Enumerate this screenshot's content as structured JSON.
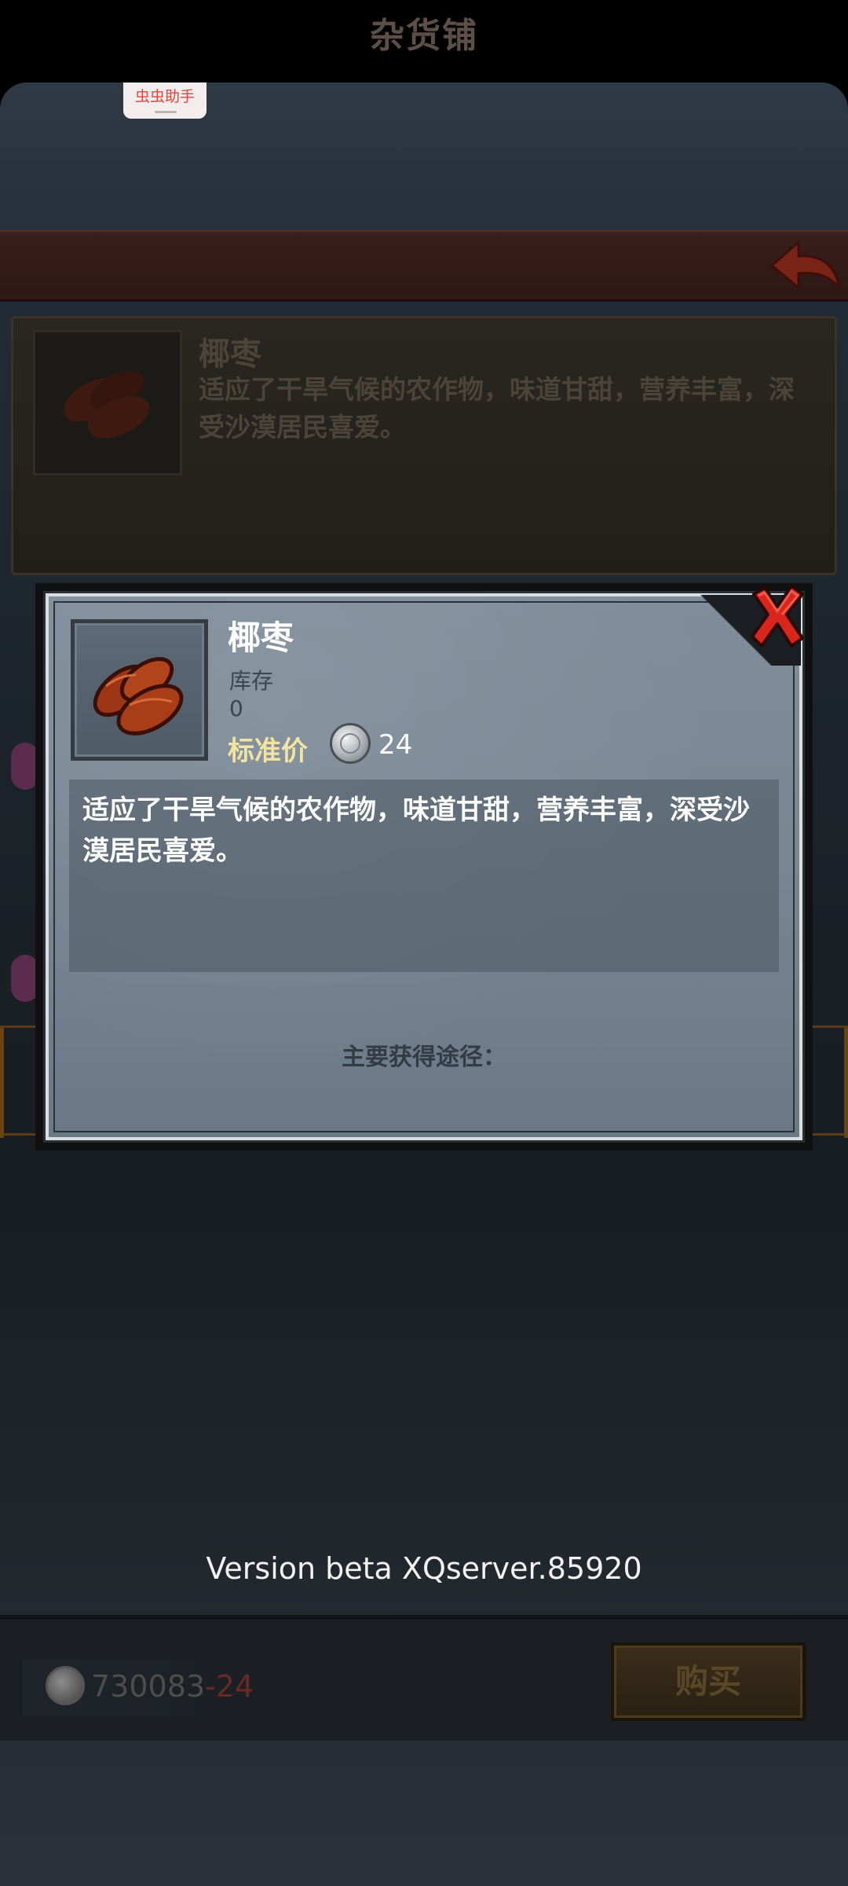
{
  "helper_tag": "虫虫助手",
  "shop": {
    "title": "杂货铺",
    "background_item": {
      "name": "椰枣",
      "description": "适应了干旱气候的农作物，味道甘甜，营养丰富，深受沙漠居民喜爱。"
    }
  },
  "popup": {
    "item_name": "椰枣",
    "stock_label": "库存",
    "stock_value": "0",
    "price_label": "标准价",
    "price_value": "24",
    "description": "适应了干旱气候的农作物，味道甘甜，营养丰富，深受沙漠居民喜爱。",
    "source_label": "主要获得途径：",
    "close_icon": "close-x-icon"
  },
  "version": "Version beta XQserver.85920",
  "footer": {
    "money": "730083",
    "cost": "-24",
    "buy_label": "购买"
  },
  "colors": {
    "title_bar": "#3a1f1c",
    "close_red": "#d8261d",
    "price_gold": "#f1e4a0",
    "date_red": "#8a2f18"
  }
}
